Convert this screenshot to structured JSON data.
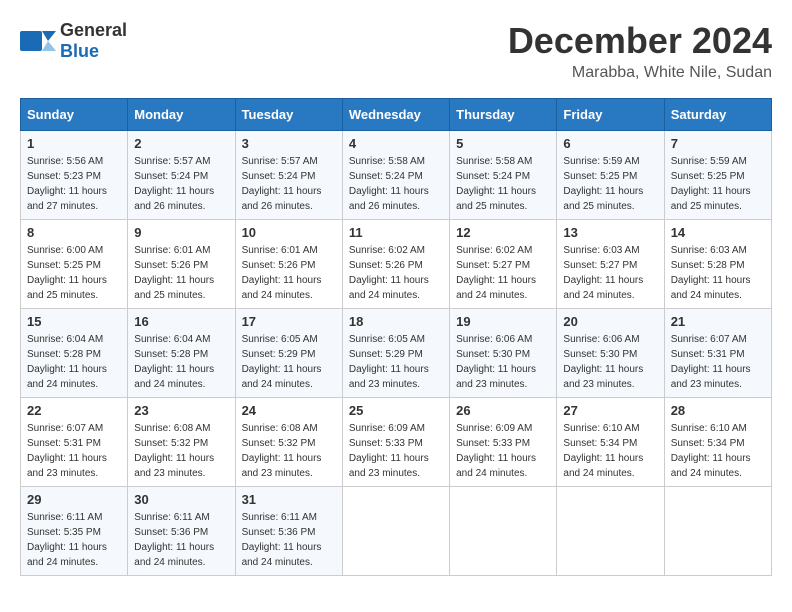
{
  "logo": {
    "text_general": "General",
    "text_blue": "Blue"
  },
  "header": {
    "month": "December 2024",
    "location": "Marabba, White Nile, Sudan"
  },
  "days_of_week": [
    "Sunday",
    "Monday",
    "Tuesday",
    "Wednesday",
    "Thursday",
    "Friday",
    "Saturday"
  ],
  "weeks": [
    [
      {
        "day": 1,
        "sunrise": "5:56 AM",
        "sunset": "5:23 PM",
        "daylight": "11 hours and 27 minutes."
      },
      {
        "day": 2,
        "sunrise": "5:57 AM",
        "sunset": "5:24 PM",
        "daylight": "11 hours and 26 minutes."
      },
      {
        "day": 3,
        "sunrise": "5:57 AM",
        "sunset": "5:24 PM",
        "daylight": "11 hours and 26 minutes."
      },
      {
        "day": 4,
        "sunrise": "5:58 AM",
        "sunset": "5:24 PM",
        "daylight": "11 hours and 26 minutes."
      },
      {
        "day": 5,
        "sunrise": "5:58 AM",
        "sunset": "5:24 PM",
        "daylight": "11 hours and 25 minutes."
      },
      {
        "day": 6,
        "sunrise": "5:59 AM",
        "sunset": "5:25 PM",
        "daylight": "11 hours and 25 minutes."
      },
      {
        "day": 7,
        "sunrise": "5:59 AM",
        "sunset": "5:25 PM",
        "daylight": "11 hours and 25 minutes."
      }
    ],
    [
      {
        "day": 8,
        "sunrise": "6:00 AM",
        "sunset": "5:25 PM",
        "daylight": "11 hours and 25 minutes."
      },
      {
        "day": 9,
        "sunrise": "6:01 AM",
        "sunset": "5:26 PM",
        "daylight": "11 hours and 25 minutes."
      },
      {
        "day": 10,
        "sunrise": "6:01 AM",
        "sunset": "5:26 PM",
        "daylight": "11 hours and 24 minutes."
      },
      {
        "day": 11,
        "sunrise": "6:02 AM",
        "sunset": "5:26 PM",
        "daylight": "11 hours and 24 minutes."
      },
      {
        "day": 12,
        "sunrise": "6:02 AM",
        "sunset": "5:27 PM",
        "daylight": "11 hours and 24 minutes."
      },
      {
        "day": 13,
        "sunrise": "6:03 AM",
        "sunset": "5:27 PM",
        "daylight": "11 hours and 24 minutes."
      },
      {
        "day": 14,
        "sunrise": "6:03 AM",
        "sunset": "5:28 PM",
        "daylight": "11 hours and 24 minutes."
      }
    ],
    [
      {
        "day": 15,
        "sunrise": "6:04 AM",
        "sunset": "5:28 PM",
        "daylight": "11 hours and 24 minutes."
      },
      {
        "day": 16,
        "sunrise": "6:04 AM",
        "sunset": "5:28 PM",
        "daylight": "11 hours and 24 minutes."
      },
      {
        "day": 17,
        "sunrise": "6:05 AM",
        "sunset": "5:29 PM",
        "daylight": "11 hours and 24 minutes."
      },
      {
        "day": 18,
        "sunrise": "6:05 AM",
        "sunset": "5:29 PM",
        "daylight": "11 hours and 23 minutes."
      },
      {
        "day": 19,
        "sunrise": "6:06 AM",
        "sunset": "5:30 PM",
        "daylight": "11 hours and 23 minutes."
      },
      {
        "day": 20,
        "sunrise": "6:06 AM",
        "sunset": "5:30 PM",
        "daylight": "11 hours and 23 minutes."
      },
      {
        "day": 21,
        "sunrise": "6:07 AM",
        "sunset": "5:31 PM",
        "daylight": "11 hours and 23 minutes."
      }
    ],
    [
      {
        "day": 22,
        "sunrise": "6:07 AM",
        "sunset": "5:31 PM",
        "daylight": "11 hours and 23 minutes."
      },
      {
        "day": 23,
        "sunrise": "6:08 AM",
        "sunset": "5:32 PM",
        "daylight": "11 hours and 23 minutes."
      },
      {
        "day": 24,
        "sunrise": "6:08 AM",
        "sunset": "5:32 PM",
        "daylight": "11 hours and 23 minutes."
      },
      {
        "day": 25,
        "sunrise": "6:09 AM",
        "sunset": "5:33 PM",
        "daylight": "11 hours and 23 minutes."
      },
      {
        "day": 26,
        "sunrise": "6:09 AM",
        "sunset": "5:33 PM",
        "daylight": "11 hours and 24 minutes."
      },
      {
        "day": 27,
        "sunrise": "6:10 AM",
        "sunset": "5:34 PM",
        "daylight": "11 hours and 24 minutes."
      },
      {
        "day": 28,
        "sunrise": "6:10 AM",
        "sunset": "5:34 PM",
        "daylight": "11 hours and 24 minutes."
      }
    ],
    [
      {
        "day": 29,
        "sunrise": "6:11 AM",
        "sunset": "5:35 PM",
        "daylight": "11 hours and 24 minutes."
      },
      {
        "day": 30,
        "sunrise": "6:11 AM",
        "sunset": "5:36 PM",
        "daylight": "11 hours and 24 minutes."
      },
      {
        "day": 31,
        "sunrise": "6:11 AM",
        "sunset": "5:36 PM",
        "daylight": "11 hours and 24 minutes."
      },
      null,
      null,
      null,
      null
    ]
  ]
}
